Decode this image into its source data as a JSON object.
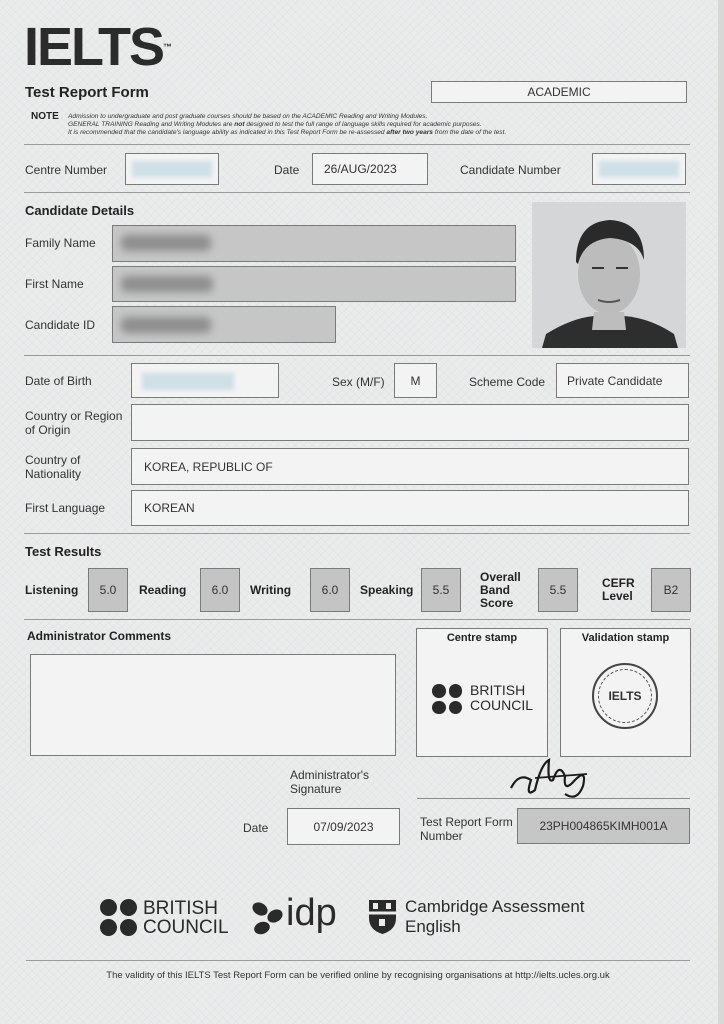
{
  "header": {
    "logo": "IELTS",
    "trademark": "™",
    "title": "Test Report Form",
    "module": "ACADEMIC",
    "note_label": "NOTE",
    "note_line1": "Admission to undergraduate and post graduate courses should be based on the ACADEMIC Reading and Writing Modules.",
    "note_line2_a": "GENERAL TRAINING Reading and Writing Modules are ",
    "note_line2_b": "not",
    "note_line2_c": " designed to test the full range of language skills required for academic purposes.",
    "note_line3_a": "It is recommended that the candidate's language ability as indicated in this Test Report Form be re-assessed ",
    "note_line3_b": "after two years",
    "note_line3_c": " from the date of the test."
  },
  "top_row": {
    "centre_number_label": "Centre Number",
    "date_label": "Date",
    "date_value": "26/AUG/2023",
    "candidate_number_label": "Candidate Number"
  },
  "candidate": {
    "heading": "Candidate Details",
    "family_name_label": "Family Name",
    "first_name_label": "First Name",
    "candidate_id_label": "Candidate ID",
    "dob_label": "Date of Birth",
    "sex_label": "Sex (M/F)",
    "sex_value": "M",
    "scheme_label": "Scheme Code",
    "scheme_value": "Private Candidate",
    "origin_label_1": "Country or Region",
    "origin_label_2": "of Origin",
    "origin_value": "",
    "nationality_label_1": "Country of",
    "nationality_label_2": "Nationality",
    "nationality_value": "KOREA, REPUBLIC OF",
    "first_language_label": "First Language",
    "first_language_value": "KOREAN"
  },
  "results": {
    "heading": "Test Results",
    "listening_label": "Listening",
    "listening": "5.0",
    "reading_label": "Reading",
    "reading": "6.0",
    "writing_label": "Writing",
    "writing": "6.0",
    "speaking_label": "Speaking",
    "speaking": "5.5",
    "overall_label_1": "Overall",
    "overall_label_2": "Band",
    "overall_label_3": "Score",
    "overall": "5.5",
    "cefr_label_1": "CEFR",
    "cefr_label_2": "Level",
    "cefr": "B2"
  },
  "admin": {
    "comments_label": "Administrator Comments",
    "centre_stamp_label": "Centre stamp",
    "validation_stamp_label": "Validation stamp",
    "stamp_bc_1": "BRITISH",
    "stamp_bc_2": "COUNCIL",
    "seal_text": "IELTS",
    "signature_label_1": "Administrator's",
    "signature_label_2": "Signature",
    "date_label": "Date",
    "date_value": "07/09/2023",
    "trf_label_1": "Test Report Form",
    "trf_label_2": "Number",
    "trf_value": "23PH004865KIMH001A"
  },
  "footer": {
    "bc_1": "BRITISH",
    "bc_2": "COUNCIL",
    "idp": "idp",
    "cambridge_1": "Cambridge Assessment",
    "cambridge_2": "English",
    "validity": "The validity of this IELTS Test Report Form can be verified online by recognising organisations at http://ielts.ucles.org.uk"
  }
}
